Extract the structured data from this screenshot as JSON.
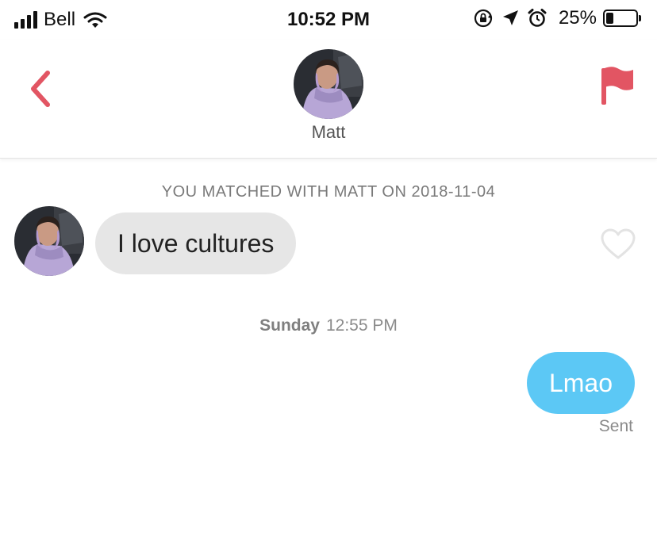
{
  "status_bar": {
    "carrier": "Bell",
    "time": "10:52 PM",
    "battery_percent": "25%",
    "battery_level": 0.25,
    "icons": [
      "signal-icon",
      "wifi-icon",
      "orientation-lock-icon",
      "location-arrow-icon",
      "alarm-icon",
      "battery-icon"
    ]
  },
  "header": {
    "name": "Matt",
    "back_icon": "chevron-left-icon",
    "report_icon": "flag-icon"
  },
  "conversation": {
    "match_banner": "YOU MATCHED WITH MATT ON 2018-11-04",
    "incoming_message": "I love cultures",
    "like_icon": "heart-outline-icon",
    "timestamp_day": "Sunday",
    "timestamp_time": "12:55 PM",
    "outgoing_message": "Lmao",
    "sent_status": "Sent"
  },
  "colors": {
    "accent_red": "#e25563",
    "outgoing_bubble": "#5cc8f5",
    "incoming_bubble": "#e6e6e6",
    "muted_text": "#8a8a8a"
  }
}
